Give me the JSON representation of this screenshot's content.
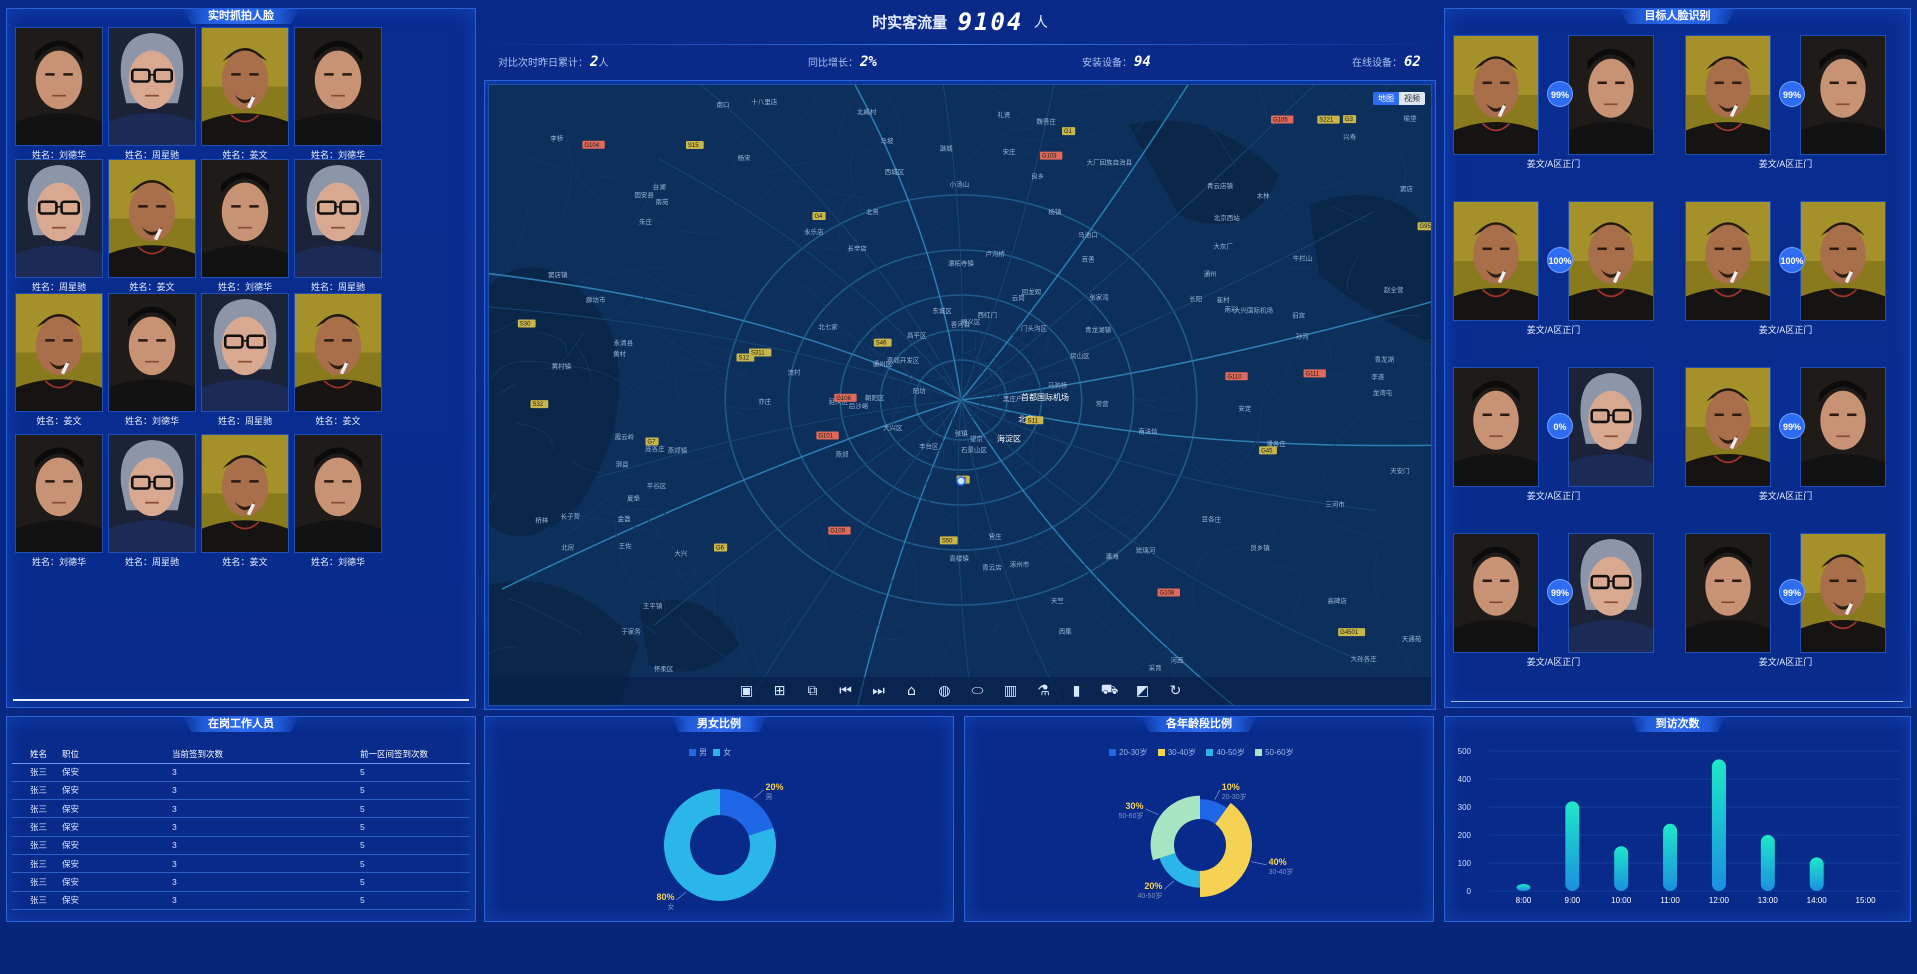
{
  "header": {
    "title": "时实客流量",
    "total": "9104",
    "unit": "人"
  },
  "stats": [
    {
      "label": "对比次时昨日累计：",
      "value": "2",
      "unit": "人"
    },
    {
      "label": "同比增长：",
      "value": "2%",
      "unit": ""
    },
    {
      "label": "安装设备：",
      "value": "94",
      "unit": ""
    },
    {
      "label": "在线设备：",
      "value": "62",
      "unit": ""
    }
  ],
  "left_panel": {
    "title": "实时抓拍人脸",
    "faces": [
      {
        "person": "liu",
        "caption": "姓名：刘德华"
      },
      {
        "person": "zhou",
        "caption": "姓名：周星驰"
      },
      {
        "person": "jiang",
        "caption": "姓名：姜文"
      },
      {
        "person": "liu",
        "caption": "姓名：刘德华"
      },
      {
        "person": "zhou",
        "caption": "姓名：周星驰"
      },
      {
        "person": "jiang",
        "caption": "姓名：姜文"
      },
      {
        "person": "liu",
        "caption": "姓名：刘德华"
      },
      {
        "person": "zhou",
        "caption": "姓名：周星驰"
      },
      {
        "person": "jiang",
        "caption": "姓名：姜文"
      },
      {
        "person": "liu",
        "caption": "姓名：刘德华"
      },
      {
        "person": "zhou",
        "caption": "姓名：周星驰"
      },
      {
        "person": "jiang",
        "caption": "姓名：姜文"
      },
      {
        "person": "liu",
        "caption": "姓名：刘德华"
      },
      {
        "person": "zhou",
        "caption": "姓名：周星驰"
      },
      {
        "person": "jiang",
        "caption": "姓名：姜文"
      },
      {
        "person": "liu",
        "caption": "姓名：刘德华"
      }
    ]
  },
  "right_panel": {
    "title": "目标人脸识别",
    "matches": [
      {
        "a": "jiang",
        "b": "liu",
        "pct": "99%",
        "caption": "姜文/A区正门"
      },
      {
        "a": "jiang",
        "b": "liu",
        "pct": "99%",
        "caption": "姜文/A区正门"
      },
      {
        "a": "jiang",
        "b": "jiang",
        "pct": "100%",
        "caption": "姜文/A区正门"
      },
      {
        "a": "jiang",
        "b": "jiang",
        "pct": "100%",
        "caption": "姜文/A区正门"
      },
      {
        "a": "liu",
        "b": "zhou",
        "pct": "0%",
        "caption": "姜文/A区正门"
      },
      {
        "a": "jiang",
        "b": "liu",
        "pct": "99%",
        "caption": "姜文/A区正门"
      },
      {
        "a": "liu",
        "b": "zhou",
        "pct": "99%",
        "caption": "姜文/A区正门"
      },
      {
        "a": "liu",
        "b": "jiang",
        "pct": "99%",
        "caption": "姜文/A区正门"
      }
    ]
  },
  "map": {
    "tabs": [
      "地图",
      "视频"
    ],
    "labels": [
      "首都国际机场",
      "北京",
      "海淀区",
      "石景山区",
      "丰台区",
      "大兴区",
      "朝阳区",
      "通州区",
      "昌平区",
      "顺义区",
      "门头沟区",
      "房山区",
      "大兴国际机场",
      "怀柔区",
      "香河县",
      "燕郊",
      "廊坊市",
      "平谷区",
      "延庆区",
      "涿州市",
      "固安县",
      "永清县",
      "三河市",
      "北京西站",
      "天安门",
      "东城区",
      "西城区",
      "亦庄",
      "良乡",
      "长辛店",
      "北七家",
      "回龙观",
      "天通苑",
      "望京",
      "通州",
      "马驹桥",
      "黄村",
      "西红门",
      "卢沟桥",
      "潭柘寺镇",
      "王平镇",
      "霞云岭",
      "青龙湖",
      "窦店",
      "琉璃河",
      "牛栏山",
      "后沙峪",
      "杨镇",
      "宋庄",
      "张家湾",
      "台湖",
      "永乐店",
      "于家务",
      "采育",
      "礼贤",
      "庞各庄",
      "魏善庄",
      "青云店",
      "长子营",
      "漷县",
      "西集",
      "燕郊镇",
      "大厂回族自治县",
      "夏垫",
      "潘各庄",
      "高楼镇",
      "燕郊开发区",
      "北臧村",
      "榆垡",
      "安定",
      "朱庄",
      "小汤山",
      "百善",
      "阳坊",
      "流村",
      "南口",
      "马池口",
      "崔村",
      "兴寿",
      "桥梓",
      "杨宋",
      "北房",
      "赵全营",
      "李桥",
      "李遂",
      "南彩",
      "张镇",
      "龙湾屯",
      "木林",
      "大孙各庄",
      "北务",
      "马坡",
      "南法信",
      "天竺",
      "孙河",
      "金盏",
      "高碑店",
      "黑庄户",
      "管庄",
      "常营",
      "豆各庄",
      "十八里店",
      "南苑",
      "旧宫",
      "瀛海",
      "青云店镇",
      "大兴",
      "黄村镇",
      "良乡镇",
      "窦店镇",
      "长阳",
      "青龙湖镇",
      "大灰厂",
      "王佐",
      "云岗",
      "河西",
      "潞城"
    ],
    "road_badges": [
      "G4501",
      "G6",
      "G7",
      "S32",
      "G1",
      "G2",
      "S12",
      "S15",
      "G45",
      "G3",
      "G4",
      "S50",
      "G101",
      "G109",
      "G110",
      "G111",
      "G103",
      "G104",
      "G105",
      "G106",
      "G108",
      "S11",
      "S30",
      "G95",
      "S46",
      "S221",
      "S311"
    ],
    "toolbar_icons": [
      "fit-icon",
      "grid-icon",
      "layer-icon",
      "rewind-icon",
      "forward-icon",
      "city-icon",
      "globe-icon",
      "satellite-icon",
      "building-icon",
      "flask-icon",
      "chart-bar-icon",
      "car-icon",
      "picture-icon",
      "refresh-icon"
    ]
  },
  "staff": {
    "title": "在岗工作人员",
    "headers": [
      "姓名",
      "职位",
      "当前签到次数",
      "前一区间签到次数"
    ],
    "rows": [
      [
        "张三",
        "保安",
        "3",
        "5"
      ],
      [
        "张三",
        "保安",
        "3",
        "5"
      ],
      [
        "张三",
        "保安",
        "3",
        "5"
      ],
      [
        "张三",
        "保安",
        "3",
        "5"
      ],
      [
        "张三",
        "保安",
        "3",
        "5"
      ],
      [
        "张三",
        "保安",
        "3",
        "5"
      ],
      [
        "张三",
        "保安",
        "3",
        "5"
      ],
      [
        "张三",
        "保安",
        "3",
        "5"
      ]
    ]
  },
  "gender": {
    "title": "男女比例",
    "legend": [
      "男",
      "女"
    ],
    "colors": [
      "#1f67e6",
      "#2bb6ea"
    ],
    "chart_data": {
      "type": "pie",
      "donut": true,
      "categories": [
        "男",
        "女"
      ],
      "values": [
        20,
        80
      ],
      "labels": [
        {
          "pct": "20%",
          "name": "男"
        },
        {
          "pct": "80%",
          "name": "女"
        }
      ]
    }
  },
  "age": {
    "title": "各年龄段比例",
    "legend": [
      "20-30岁",
      "30-40岁",
      "40-50岁",
      "50-60岁"
    ],
    "colors": [
      "#1f67e6",
      "#f6d252",
      "#2bb6ea",
      "#a8e6c3"
    ],
    "chart_data": {
      "type": "pie",
      "donut": true,
      "categories": [
        "20-30岁",
        "30-40岁",
        "40-50岁",
        "50-60岁"
      ],
      "values": [
        10,
        40,
        20,
        30
      ],
      "labels": [
        {
          "pct": "10%",
          "name": "20-30岁"
        },
        {
          "pct": "40%",
          "name": "30-40岁"
        },
        {
          "pct": "20%",
          "name": "40-50岁"
        },
        {
          "pct": "30%",
          "name": "50-60岁"
        }
      ]
    }
  },
  "visits": {
    "title": "到访次数",
    "chart_data": {
      "type": "bar",
      "categories": [
        "8:00",
        "9:00",
        "10:00",
        "11:00",
        "12:00",
        "13:00",
        "14:00",
        "15:00"
      ],
      "values": [
        25,
        320,
        160,
        240,
        470,
        200,
        120,
        0
      ],
      "ylim": [
        0,
        500
      ],
      "yticks": [
        "0",
        "100",
        "200",
        "300",
        "400",
        "500"
      ],
      "grid": true
    }
  }
}
